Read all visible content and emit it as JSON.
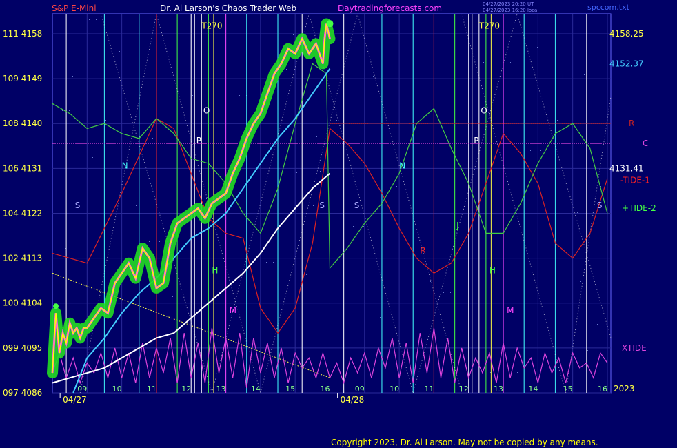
{
  "header": {
    "instrument": "S&P E-Mini",
    "site_title": "Dr. Al Larson's Chaos Trader Web",
    "url": "Daytradingforecasts.com",
    "timestamp_1": "04/27/2023 20:20 UT",
    "timestamp_2": "04/27/2023 16:20 local",
    "filename": "spccom.txt"
  },
  "footer": {
    "copyright": "Copyright 2023, Dr. Al Larson. May not be copied by any means."
  },
  "colors": {
    "background": "#000066",
    "price_line": "#ffff00",
    "price_glow": "#22dd22",
    "price_inner": "#ff44ff",
    "fast_avg": "#44ccff",
    "slow_avg": "#ffffff",
    "tide1": "#dd2222",
    "tide2": "#44cc44",
    "xtide": "#dd44dd",
    "level_r": "#cc2222",
    "level_c": "#dd44dd"
  },
  "chart_data": {
    "type": "line",
    "title": "S&P E-Mini",
    "ylim": [
      4086,
      4162
    ],
    "y_ticks": [
      {
        "idx": "097",
        "price": "4086"
      },
      {
        "idx": "099",
        "price": "4095"
      },
      {
        "idx": "100",
        "price": "4104"
      },
      {
        "idx": "102",
        "price": "4113"
      },
      {
        "idx": "104",
        "price": "4122"
      },
      {
        "idx": "106",
        "price": "4131"
      },
      {
        "idx": "108",
        "price": "4140"
      },
      {
        "idx": "109",
        "price": "4149"
      },
      {
        "idx": "111",
        "price": "4158"
      }
    ],
    "x_ticks": [
      {
        "t": 9,
        "label": "09"
      },
      {
        "t": 10,
        "label": "10"
      },
      {
        "t": 11,
        "label": "11"
      },
      {
        "t": 12,
        "label": "12"
      },
      {
        "t": 13,
        "label": "13"
      },
      {
        "t": 14,
        "label": "14"
      },
      {
        "t": 15,
        "label": "15"
      },
      {
        "t": 16,
        "label": "16"
      },
      {
        "t": 17,
        "label": "09"
      },
      {
        "t": 18,
        "label": "10"
      },
      {
        "t": 19,
        "label": "11"
      },
      {
        "t": 20,
        "label": "12"
      },
      {
        "t": 21,
        "label": "13"
      },
      {
        "t": 22,
        "label": "14"
      },
      {
        "t": 23,
        "label": "15"
      },
      {
        "t": 24,
        "label": "16"
      }
    ],
    "date_labels": [
      {
        "t": 8.5,
        "label": "04/27"
      },
      {
        "t": 16.5,
        "label": "04/28"
      }
    ],
    "year_label": "2023",
    "series": [
      {
        "key": "price",
        "x": [
          8.0,
          8.1,
          8.2,
          8.3,
          8.4,
          8.5,
          8.6,
          8.7,
          8.8,
          8.9,
          9.0,
          9.2,
          9.4,
          9.6,
          9.8,
          10.0,
          10.2,
          10.4,
          10.6,
          10.8,
          11.0,
          11.2,
          11.4,
          11.6,
          11.8,
          12.0,
          12.2,
          12.4,
          12.6,
          12.8,
          13.0,
          13.2,
          13.4,
          13.6,
          13.8,
          14.0,
          14.2,
          14.4,
          14.6,
          14.8,
          15.0,
          15.2,
          15.4,
          15.6,
          15.8,
          15.85,
          15.9,
          16.0
        ],
        "y": [
          4090,
          4102,
          4094,
          4098,
          4096,
          4100,
          4098,
          4099,
          4097,
          4099,
          4099,
          4101,
          4103,
          4102,
          4108,
          4110,
          4112,
          4109,
          4115,
          4113,
          4107,
          4108,
          4116,
          4120,
          4121,
          4122,
          4123,
          4121,
          4124,
          4125,
          4126,
          4130,
          4133,
          4137,
          4140,
          4142,
          4146,
          4150,
          4152,
          4155,
          4154,
          4157,
          4154,
          4156,
          4152,
          4157,
          4160,
          4157
        ]
      },
      {
        "key": "fast_avg",
        "x": [
          8.6,
          9.0,
          9.5,
          10.0,
          10.5,
          11.0,
          11.5,
          12.0,
          12.5,
          13.0,
          13.5,
          14.0,
          14.5,
          15.0,
          15.5,
          16.0
        ],
        "y": [
          4086,
          4093,
          4097,
          4102,
          4106,
          4109,
          4113,
          4117,
          4119,
          4122,
          4127,
          4132,
          4137,
          4141,
          4146,
          4151
        ]
      },
      {
        "key": "slow_avg",
        "x": [
          8.0,
          8.5,
          9.0,
          9.5,
          10.0,
          10.5,
          11.0,
          11.5,
          12.0,
          12.5,
          13.0,
          13.5,
          14.0,
          14.5,
          15.0,
          15.5,
          16.0
        ],
        "y": [
          4088,
          4089,
          4090,
          4091,
          4093,
          4095,
          4097,
          4098,
          4101,
          4104,
          4107,
          4110,
          4114,
          4119,
          4123,
          4127,
          4130
        ]
      },
      {
        "key": "tide1",
        "x": [
          8.0,
          9.0,
          10.0,
          11.0,
          11.5,
          12.0,
          12.5,
          13.0,
          13.5,
          14.0,
          14.5,
          15.0,
          15.5,
          16.0,
          16.5,
          17.0,
          17.5,
          18.0,
          18.5,
          19.0,
          19.5,
          20.0,
          20.5,
          21.0,
          21.5,
          22.0,
          22.5,
          23.0,
          23.5,
          24.0
        ],
        "y": [
          4114,
          4112,
          4126,
          4141,
          4139,
          4130,
          4121,
          4118,
          4117,
          4103,
          4098,
          4103,
          4116,
          4139,
          4136,
          4132,
          4126,
          4119,
          4113,
          4110,
          4112,
          4118,
          4128,
          4138,
          4134,
          4128,
          4116,
          4113,
          4118,
          4129
        ]
      },
      {
        "key": "tide2",
        "x": [
          8.0,
          8.5,
          9.0,
          9.5,
          10.0,
          10.5,
          11.0,
          11.5,
          12.0,
          12.5,
          13.0,
          13.5,
          14.0,
          14.5,
          15.0,
          15.5,
          15.9,
          16.0,
          16.5,
          17.0,
          17.5,
          18.0,
          18.5,
          19.0,
          19.5,
          20.0,
          20.5,
          21.0,
          21.5,
          22.0,
          22.5,
          23.0,
          23.5,
          24.0
        ],
        "y": [
          4144,
          4142,
          4139,
          4140,
          4138,
          4137,
          4141,
          4138,
          4133,
          4132,
          4128,
          4122,
          4118,
          4127,
          4140,
          4152,
          4150,
          4111,
          4115,
          4120,
          4124,
          4130,
          4140,
          4143,
          4135,
          4128,
          4118,
          4118,
          4124,
          4132,
          4138,
          4140,
          4135,
          4122
        ]
      },
      {
        "key": "xtide",
        "x": [
          8.0,
          8.2,
          8.4,
          8.6,
          8.8,
          9.0,
          9.2,
          9.4,
          9.6,
          9.8,
          10.0,
          10.2,
          10.4,
          10.6,
          10.8,
          11.0,
          11.2,
          11.4,
          11.6,
          11.8,
          12.0,
          12.2,
          12.4,
          12.6,
          12.8,
          13.0,
          13.2,
          13.4,
          13.6,
          13.8,
          14.0,
          14.2,
          14.4,
          14.6,
          14.8,
          15.0,
          15.2,
          15.4,
          15.6,
          15.8,
          16.0,
          16.2,
          16.4,
          16.6,
          16.8,
          17.0,
          17.2,
          17.4,
          17.6,
          17.8,
          18.0,
          18.2,
          18.4,
          18.6,
          18.8,
          19.0,
          19.2,
          19.4,
          19.6,
          19.8,
          20.0,
          20.2,
          20.4,
          20.6,
          20.8,
          21.0,
          21.2,
          21.4,
          21.6,
          21.8,
          22.0,
          22.2,
          22.4,
          22.6,
          22.8,
          23.0,
          23.2,
          23.4,
          23.6,
          23.8,
          24.0
        ],
        "y": [
          4090,
          4094,
          4089,
          4093,
          4088,
          4092,
          4090,
          4094,
          4089,
          4095,
          4089,
          4094,
          4088,
          4096,
          4089,
          4095,
          4090,
          4097,
          4088,
          4098,
          4089,
          4096,
          4088,
          4099,
          4090,
          4097,
          4089,
          4098,
          4087,
          4097,
          4090,
          4096,
          4089,
          4095,
          4088,
          4094,
          4091,
          4093,
          4089,
          4094,
          4089,
          4092,
          4088,
          4093,
          4090,
          4094,
          4089,
          4095,
          4091,
          4097,
          4089,
          4096,
          4088,
          4098,
          4090,
          4099,
          4089,
          4097,
          4088,
          4095,
          4089,
          4093,
          4090,
          4094,
          4088,
          4096,
          4089,
          4095,
          4091,
          4093,
          4088,
          4094,
          4090,
          4093,
          4088,
          4094,
          4091,
          4092,
          4089,
          4094,
          4092
        ]
      }
    ],
    "horizontal_levels": [
      {
        "key": "r",
        "y": 4140
      },
      {
        "key": "c",
        "y": 4136
      },
      {
        "key": "trend",
        "x1": 8.0,
        "y1": 4110,
        "x2": 16.0,
        "y2": 4089
      }
    ],
    "vertical_lines": [
      {
        "t": 8.4,
        "color": "#ffffff"
      },
      {
        "t": 9.5,
        "color": "#44ffff"
      },
      {
        "t": 10.5,
        "color": "#44ffff"
      },
      {
        "t": 11.0,
        "color": "#ff2222"
      },
      {
        "t": 11.6,
        "color": "#44ff44"
      },
      {
        "t": 12.0,
        "color": "#ffffff"
      },
      {
        "t": 12.1,
        "color": "#ffffff"
      },
      {
        "t": 12.3,
        "color": "#ffffff"
      },
      {
        "t": 12.5,
        "color": "#44ff44"
      },
      {
        "t": 12.65,
        "color": "#ffff44"
      },
      {
        "t": 13.0,
        "color": "#ff44ff"
      },
      {
        "t": 13.6,
        "color": "#44ffff"
      },
      {
        "t": 14.5,
        "color": "#44ffff"
      },
      {
        "t": 15.2,
        "color": "#ffffff"
      },
      {
        "t": 16.4,
        "color": "#ffffff"
      },
      {
        "t": 17.5,
        "color": "#44ffff"
      },
      {
        "t": 18.4,
        "color": "#44ffff"
      },
      {
        "t": 19.0,
        "color": "#ff2222"
      },
      {
        "t": 19.6,
        "color": "#44ff44"
      },
      {
        "t": 20.0,
        "color": "#ffffff"
      },
      {
        "t": 20.1,
        "color": "#ffffff"
      },
      {
        "t": 20.3,
        "color": "#ffffff"
      },
      {
        "t": 20.5,
        "color": "#44ff44"
      },
      {
        "t": 20.65,
        "color": "#ffff44"
      },
      {
        "t": 21.0,
        "color": "#ff44ff"
      },
      {
        "t": 21.6,
        "color": "#44ffff"
      },
      {
        "t": 22.5,
        "color": "#44ffff"
      },
      {
        "t": 23.4,
        "color": "#ffffff"
      }
    ],
    "markers": [
      {
        "text": "T270",
        "t": 12.3,
        "y": 4159,
        "color": "#ffff44"
      },
      {
        "text": "T270",
        "t": 20.3,
        "y": 4159,
        "color": "#ffff44"
      },
      {
        "text": "O",
        "t": 12.35,
        "y": 4142,
        "color": "#ffffff"
      },
      {
        "text": "O",
        "t": 20.35,
        "y": 4142,
        "color": "#ffffff"
      },
      {
        "text": "P",
        "t": 12.15,
        "y": 4136,
        "color": "#ffffff"
      },
      {
        "text": "P",
        "t": 20.15,
        "y": 4136,
        "color": "#ffffff"
      },
      {
        "text": "N",
        "t": 10.0,
        "y": 4131,
        "color": "#44ffff"
      },
      {
        "text": "N",
        "t": 18.0,
        "y": 4131,
        "color": "#44ffff"
      },
      {
        "text": "S",
        "t": 8.65,
        "y": 4123,
        "color": "#aaaaff"
      },
      {
        "text": "S",
        "t": 15.7,
        "y": 4123,
        "color": "#aaaaff"
      },
      {
        "text": "S",
        "t": 16.7,
        "y": 4123,
        "color": "#aaaaff"
      },
      {
        "text": "S",
        "t": 23.7,
        "y": 4123,
        "color": "#aaaaff"
      },
      {
        "text": "H",
        "t": 12.6,
        "y": 4110,
        "color": "#44ff44"
      },
      {
        "text": "H",
        "t": 20.6,
        "y": 4110,
        "color": "#44ff44"
      },
      {
        "text": "J",
        "t": 19.65,
        "y": 4119,
        "color": "#44ff44"
      },
      {
        "text": "R",
        "t": 18.6,
        "y": 4114,
        "color": "#ff2222"
      },
      {
        "text": "M",
        "t": 13.1,
        "y": 4102,
        "color": "#ff44ff"
      },
      {
        "text": "M",
        "t": 21.1,
        "y": 4102,
        "color": "#ff44ff"
      }
    ],
    "right_labels": [
      {
        "text": "4158.25",
        "y": 4158,
        "color": "#ffff44"
      },
      {
        "text": "4152.37",
        "y": 4152,
        "color": "#44ccff"
      },
      {
        "text": "R",
        "y": 4140,
        "color": "#cc2222"
      },
      {
        "text": "C",
        "y": 4136,
        "color": "#dd44dd"
      },
      {
        "text": "4131.41",
        "y": 4131,
        "color": "#ffffff"
      },
      {
        "text": "-TIDE-1",
        "y": 4130,
        "color": "#ff2222"
      },
      {
        "text": "+TIDE-2",
        "y": 4123,
        "color": "#44ff44"
      },
      {
        "text": "XTIDE",
        "y": 4095,
        "color": "#dd44dd"
      }
    ]
  }
}
